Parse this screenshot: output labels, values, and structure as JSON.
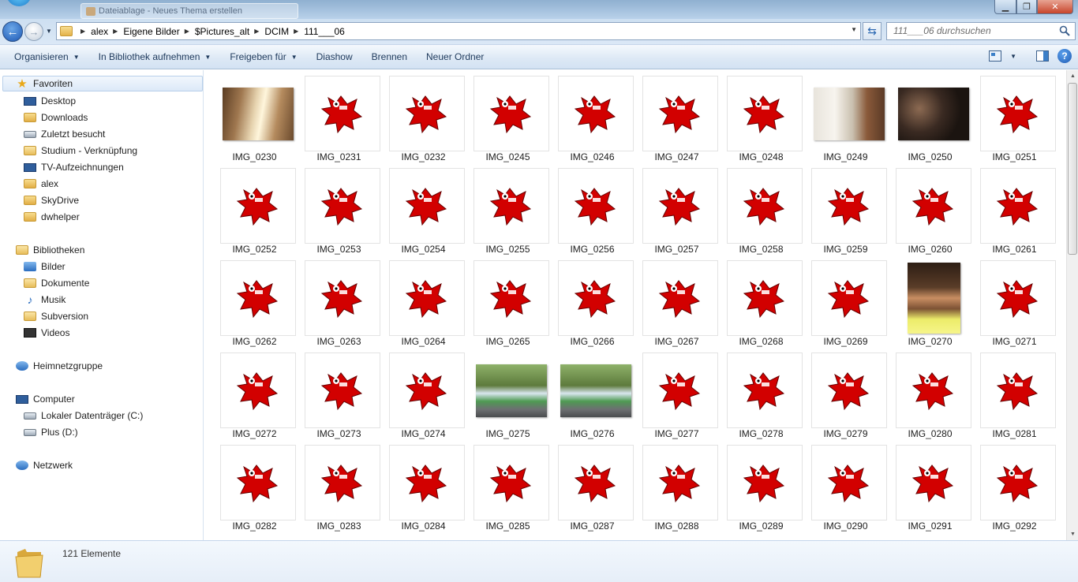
{
  "titlebar": {
    "background_tab": "Dateiablage - Neues Thema erstellen"
  },
  "navbar": {
    "breadcrumbs": [
      "alex",
      "Eigene Bilder",
      "$Pictures_alt",
      "DCIM",
      "111___06"
    ],
    "search_placeholder": "111___06 durchsuchen"
  },
  "toolbar": {
    "items": [
      {
        "label": "Organisieren",
        "dropdown": true
      },
      {
        "label": "In Bibliothek aufnehmen",
        "dropdown": true
      },
      {
        "label": "Freigeben für",
        "dropdown": true
      },
      {
        "label": "Diashow",
        "dropdown": false
      },
      {
        "label": "Brennen",
        "dropdown": false
      },
      {
        "label": "Neuer Ordner",
        "dropdown": false
      }
    ]
  },
  "sidebar": {
    "favoriten": {
      "label": "Favoriten",
      "items": [
        "Desktop",
        "Downloads",
        "Zuletzt besucht",
        "Studium - Verknüpfung",
        "TV-Aufzeichnungen",
        "alex",
        "SkyDrive",
        "dwhelper"
      ]
    },
    "bibliotheken": {
      "label": "Bibliotheken",
      "items": [
        "Bilder",
        "Dokumente",
        "Musik",
        "Subversion",
        "Videos"
      ]
    },
    "heimnetzgruppe": {
      "label": "Heimnetzgruppe"
    },
    "computer": {
      "label": "Computer",
      "items": [
        "Lokaler Datenträger (C:)",
        "Plus (D:)"
      ]
    },
    "netzwerk": {
      "label": "Netzwerk"
    }
  },
  "files": [
    {
      "name": "IMG_0230",
      "thumb": "photo-kitchen"
    },
    {
      "name": "IMG_0231",
      "thumb": "broken-image-icon"
    },
    {
      "name": "IMG_0232",
      "thumb": "broken-image-icon"
    },
    {
      "name": "IMG_0245",
      "thumb": "broken-image-icon"
    },
    {
      "name": "IMG_0246",
      "thumb": "broken-image-icon"
    },
    {
      "name": "IMG_0247",
      "thumb": "broken-image-icon"
    },
    {
      "name": "IMG_0248",
      "thumb": "broken-image-icon"
    },
    {
      "name": "IMG_0249",
      "thumb": "photo-room"
    },
    {
      "name": "IMG_0250",
      "thumb": "photo-dark"
    },
    {
      "name": "IMG_0251",
      "thumb": "broken-image-icon"
    },
    {
      "name": "IMG_0252",
      "thumb": "broken-image-icon"
    },
    {
      "name": "IMG_0253",
      "thumb": "broken-image-icon"
    },
    {
      "name": "IMG_0254",
      "thumb": "broken-image-icon"
    },
    {
      "name": "IMG_0255",
      "thumb": "broken-image-icon"
    },
    {
      "name": "IMG_0256",
      "thumb": "broken-image-icon"
    },
    {
      "name": "IMG_0257",
      "thumb": "broken-image-icon"
    },
    {
      "name": "IMG_0258",
      "thumb": "broken-image-icon"
    },
    {
      "name": "IMG_0259",
      "thumb": "broken-image-icon"
    },
    {
      "name": "IMG_0260",
      "thumb": "broken-image-icon"
    },
    {
      "name": "IMG_0261",
      "thumb": "broken-image-icon"
    },
    {
      "name": "IMG_0262",
      "thumb": "broken-image-icon"
    },
    {
      "name": "IMG_0263",
      "thumb": "broken-image-icon"
    },
    {
      "name": "IMG_0264",
      "thumb": "broken-image-icon"
    },
    {
      "name": "IMG_0265",
      "thumb": "broken-image-icon"
    },
    {
      "name": "IMG_0266",
      "thumb": "broken-image-icon"
    },
    {
      "name": "IMG_0267",
      "thumb": "broken-image-icon"
    },
    {
      "name": "IMG_0268",
      "thumb": "broken-image-icon"
    },
    {
      "name": "IMG_0269",
      "thumb": "broken-image-icon"
    },
    {
      "name": "IMG_0270",
      "thumb": "photo-portrait"
    },
    {
      "name": "IMG_0271",
      "thumb": "broken-image-icon"
    },
    {
      "name": "IMG_0272",
      "thumb": "broken-image-icon"
    },
    {
      "name": "IMG_0273",
      "thumb": "broken-image-icon"
    },
    {
      "name": "IMG_0274",
      "thumb": "broken-image-icon"
    },
    {
      "name": "IMG_0275",
      "thumb": "photo-bus"
    },
    {
      "name": "IMG_0276",
      "thumb": "photo-bus"
    },
    {
      "name": "IMG_0277",
      "thumb": "broken-image-icon"
    },
    {
      "name": "IMG_0278",
      "thumb": "broken-image-icon"
    },
    {
      "name": "IMG_0279",
      "thumb": "broken-image-icon"
    },
    {
      "name": "IMG_0280",
      "thumb": "broken-image-icon"
    },
    {
      "name": "IMG_0281",
      "thumb": "broken-image-icon"
    },
    {
      "name": "IMG_0282",
      "thumb": "broken-image-icon"
    },
    {
      "name": "IMG_0283",
      "thumb": "broken-image-icon"
    },
    {
      "name": "IMG_0284",
      "thumb": "broken-image-icon"
    },
    {
      "name": "IMG_0285",
      "thumb": "broken-image-icon"
    },
    {
      "name": "IMG_0287",
      "thumb": "broken-image-icon"
    },
    {
      "name": "IMG_0288",
      "thumb": "broken-image-icon"
    },
    {
      "name": "IMG_0289",
      "thumb": "broken-image-icon"
    },
    {
      "name": "IMG_0290",
      "thumb": "broken-image-icon"
    },
    {
      "name": "IMG_0291",
      "thumb": "broken-image-icon"
    },
    {
      "name": "IMG_0292",
      "thumb": "broken-image-icon"
    }
  ],
  "details": {
    "count": "121 Elemente"
  },
  "colors": {
    "broken_icon": "#d20000",
    "toolbar_text": "#1e395b"
  }
}
